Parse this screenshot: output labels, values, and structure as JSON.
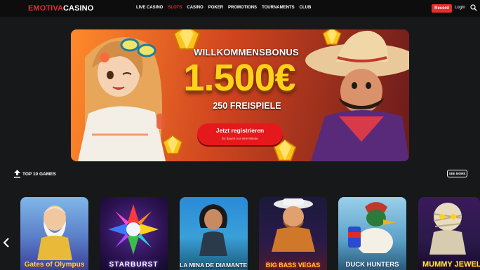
{
  "header": {
    "logo_part1": "EMOTIVA",
    "logo_part2": "CASINO",
    "nav": [
      "LIVE CASINO",
      "SLOTS",
      "CASINO",
      "POKER",
      "PROMOTIONS",
      "TOURNAMENTS",
      "CLUB"
    ],
    "active_nav": "SLOTS",
    "record_label": "Record",
    "login_label": "Login",
    "search_icon": "search-icon"
  },
  "banner": {
    "welcome": "WILLKOMMENSBONUS",
    "amount": "1.500€",
    "spins": "250 FREISPIELE",
    "cta_label": "Jetzt registrieren",
    "cta_sub": "Es dauert nur eine Minute"
  },
  "games_section": {
    "title": "TOP 10 GAMES",
    "see_more": "SEE MORE",
    "games": [
      {
        "title": "Gates of Olympus"
      },
      {
        "title": "STARBURST"
      },
      {
        "title": "LA MINA DE DIAMANTES"
      },
      {
        "title": "BIG BASS VEGAS"
      },
      {
        "title": "DUCK HUNTERS"
      },
      {
        "title": "MUMMY JEWELS"
      }
    ]
  },
  "colors": {
    "accent": "#e52d2d",
    "gold": "#ffd21a",
    "background": "#17181a"
  }
}
